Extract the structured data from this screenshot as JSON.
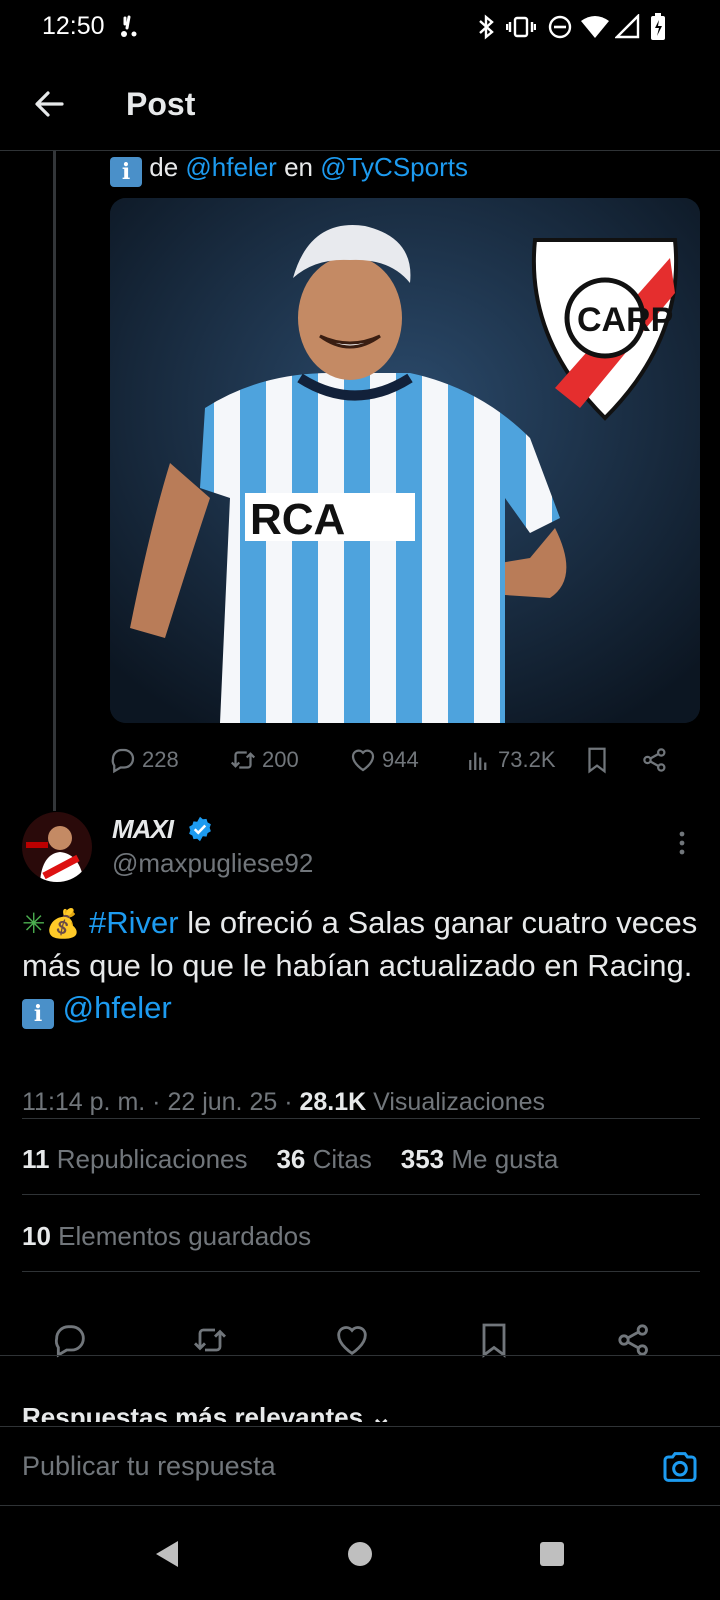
{
  "status_bar": {
    "time": "12:50",
    "icons": [
      "notification-icon",
      "bluetooth-icon",
      "vibrate-icon",
      "dnd-icon",
      "wifi-icon",
      "cell-signal-icon",
      "battery-icon"
    ]
  },
  "header": {
    "title": "Post"
  },
  "quoted_post": {
    "source_prefix": "de",
    "source_handle_1": "@hfeler",
    "source_mid": "en",
    "source_handle_2": "@TyCSports",
    "stats": {
      "replies": "228",
      "reposts": "200",
      "likes": "944",
      "views": "73.2K"
    }
  },
  "main_post": {
    "author_name": "MAXI",
    "author_handle": "@maxpugliese92",
    "text_hashtag": "#River",
    "text_body": "le ofreció a Salas ganar cuatro veces más que lo que le habían actualizado en Racing.",
    "text_mention": "@hfeler",
    "time": "11:14 p. m.",
    "date": "22 jun. 25",
    "views_count": "28.1K",
    "views_label": "Visualizaciones",
    "reposts_count": "11",
    "reposts_label": "Republicaciones",
    "quotes_count": "36",
    "quotes_label": "Citas",
    "likes_count": "353",
    "likes_label": "Me gusta",
    "bookmarks_count": "10",
    "bookmarks_label": "Elementos guardados"
  },
  "replies_header": "Respuestas más relevantes",
  "reply_bar": {
    "placeholder": "Publicar tu respuesta"
  },
  "colors": {
    "accent": "#1d9bf0",
    "background": "#000000",
    "muted": "#71767b",
    "divider": "#2f3336"
  }
}
